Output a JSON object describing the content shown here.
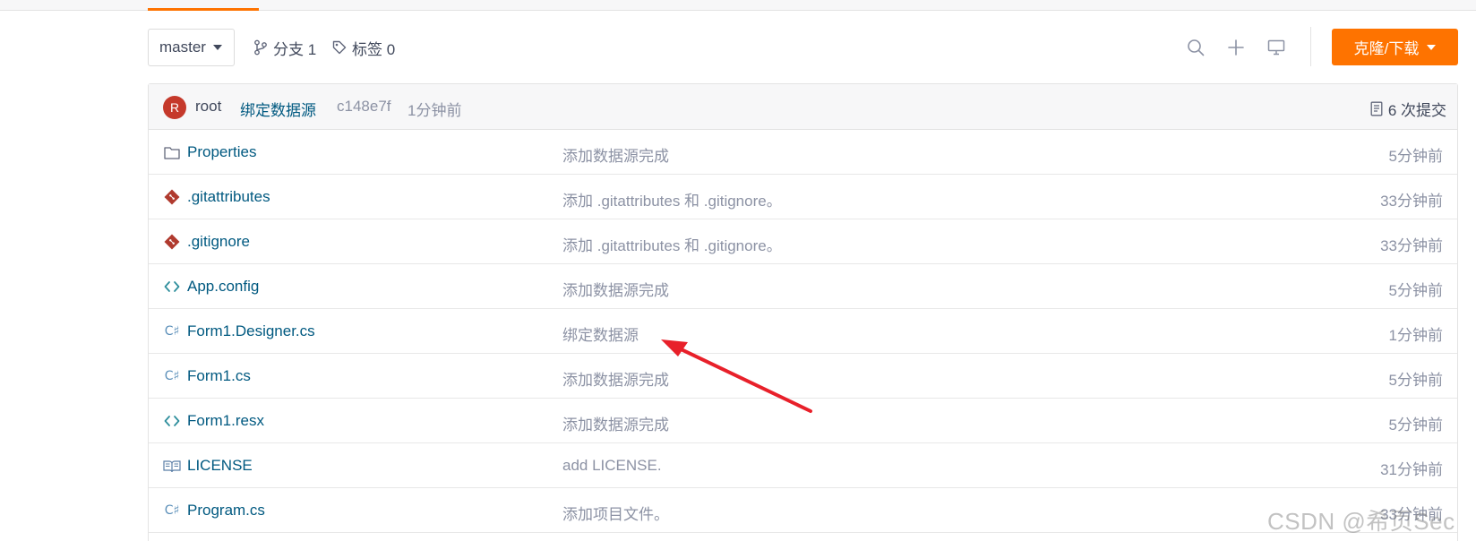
{
  "toolbar": {
    "branch": "master",
    "branch_count_label": "分支 1",
    "tag_count_label": "标签 0",
    "clone_label": "克隆/下载"
  },
  "latest_commit": {
    "avatar_letter": "R",
    "author": "root",
    "message": "绑定数据源",
    "sha": "c148e7f",
    "time": "1分钟前",
    "commit_count": "6 次提交"
  },
  "files": [
    {
      "icon": "folder-icon",
      "name": "Properties",
      "message": "添加数据源完成",
      "time": "5分钟前"
    },
    {
      "icon": "git-file-icon",
      "name": ".gitattributes",
      "message": "添加 .gitattributes 和 .gitignore。",
      "time": "33分钟前"
    },
    {
      "icon": "git-file-icon",
      "name": ".gitignore",
      "message": "添加 .gitattributes 和 .gitignore。",
      "time": "33分钟前"
    },
    {
      "icon": "code-icon",
      "name": "App.config",
      "message": "添加数据源完成",
      "time": "5分钟前"
    },
    {
      "icon": "csharp-icon",
      "name": "Form1.Designer.cs",
      "message": "绑定数据源",
      "time": "1分钟前"
    },
    {
      "icon": "csharp-icon",
      "name": "Form1.cs",
      "message": "添加数据源完成",
      "time": "5分钟前"
    },
    {
      "icon": "code-icon",
      "name": "Form1.resx",
      "message": "添加数据源完成",
      "time": "5分钟前"
    },
    {
      "icon": "book-icon",
      "name": "LICENSE",
      "message": "add LICENSE.",
      "time": "31分钟前"
    },
    {
      "icon": "csharp-icon",
      "name": "Program.cs",
      "message": "添加项目文件。",
      "time": "33分钟前"
    }
  ],
  "colors": {
    "accent": "#fe7300",
    "link": "#005980",
    "muted": "#8c92a4",
    "annotation_arrow": "#e8202a"
  },
  "watermark": "CSDN @希页Sec"
}
